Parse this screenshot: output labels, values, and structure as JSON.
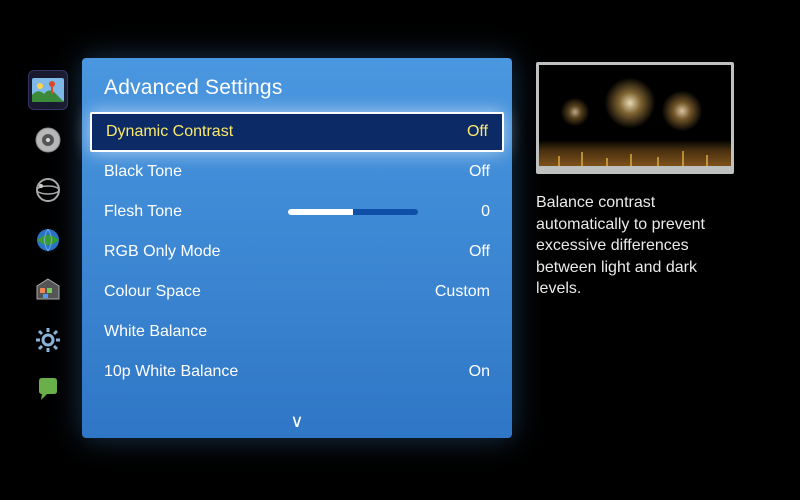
{
  "title": "Advanced Settings",
  "sidebar": {
    "items": [
      {
        "icon": "picture-icon",
        "active": true
      },
      {
        "icon": "sound-icon",
        "active": false
      },
      {
        "icon": "channel-icon",
        "active": false
      },
      {
        "icon": "network-icon",
        "active": false
      },
      {
        "icon": "smart-hub-icon",
        "active": false
      },
      {
        "icon": "system-icon",
        "active": false
      },
      {
        "icon": "support-icon",
        "active": false
      }
    ]
  },
  "menu": {
    "items": [
      {
        "label": "Dynamic Contrast",
        "value": "Off",
        "type": "enum",
        "selected": true
      },
      {
        "label": "Black Tone",
        "value": "Off",
        "type": "enum",
        "selected": false
      },
      {
        "label": "Flesh Tone",
        "value": "0",
        "type": "slider",
        "slider_fill_pct": 50,
        "selected": false
      },
      {
        "label": "RGB Only Mode",
        "value": "Off",
        "type": "enum",
        "selected": false
      },
      {
        "label": "Colour Space",
        "value": "Custom",
        "type": "enum",
        "selected": false
      },
      {
        "label": "White Balance",
        "value": "",
        "type": "submenu",
        "selected": false
      },
      {
        "label": "10p White Balance",
        "value": "On",
        "type": "enum",
        "selected": false
      }
    ],
    "has_more_below": true
  },
  "help": {
    "text": "Balance contrast automatically to prevent excessive differences between light and dark levels."
  },
  "preview": {
    "description": "fireworks-over-city-night"
  }
}
